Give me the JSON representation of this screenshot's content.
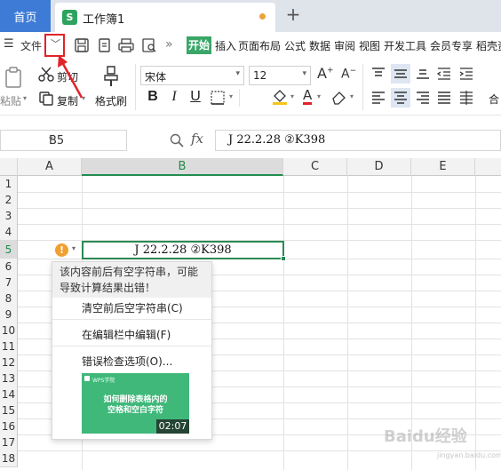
{
  "tabs": {
    "home": "首页",
    "document": "工作簿1",
    "doc_logo": "S",
    "new_tab": "+"
  },
  "menu": {
    "file": "文件",
    "more": "»",
    "items": [
      "开始",
      "插入",
      "页面布局",
      "公式",
      "数据",
      "审阅",
      "视图",
      "开发工具",
      "会员专享",
      "稻壳资"
    ]
  },
  "ribbon": {
    "paste": "粘贴",
    "cut": "剪切",
    "copy": "复制",
    "format_painter": "格式刷",
    "font_name": "宋体",
    "font_size": "12",
    "bold": "B",
    "italic": "I",
    "underline": "U",
    "merge": "合"
  },
  "formula_bar": {
    "cell_ref": "B5",
    "fx": "fx",
    "content": "J 22.2.28 ②K398"
  },
  "sheet": {
    "columns": [
      "A",
      "B",
      "C",
      "D",
      "E"
    ],
    "rows": [
      "1",
      "2",
      "3",
      "4",
      "5",
      "6",
      "7",
      "8",
      "9",
      "10",
      "11",
      "12",
      "13",
      "14",
      "15",
      "16",
      "17",
      "18"
    ],
    "active_col": "B",
    "active_row": "5",
    "cell_b5": "J 22.2.28 ②K398"
  },
  "popup": {
    "warning": "!",
    "message_line1": "该内容前后有空字符串，可能",
    "message_line2": "导致计算结果出错！",
    "items": [
      "清空前后空字符串(C)",
      "在编辑栏中编辑(F)",
      "错误检查选项(O)..."
    ],
    "video_brand": "WPS学院",
    "video_title_line1": "如何删除表格内的",
    "video_title_line2": "空格和空白字符",
    "video_duration": "02:07"
  },
  "watermark": {
    "text": "Baidu经验",
    "sub": "jingyan.baidu.com"
  },
  "colors": {
    "home_tab": "#3d7bd6",
    "accent_green": "#2a8a52",
    "start_tab": "#3aa668",
    "highlight_box": "#e0232a",
    "warning": "#f0a030"
  }
}
